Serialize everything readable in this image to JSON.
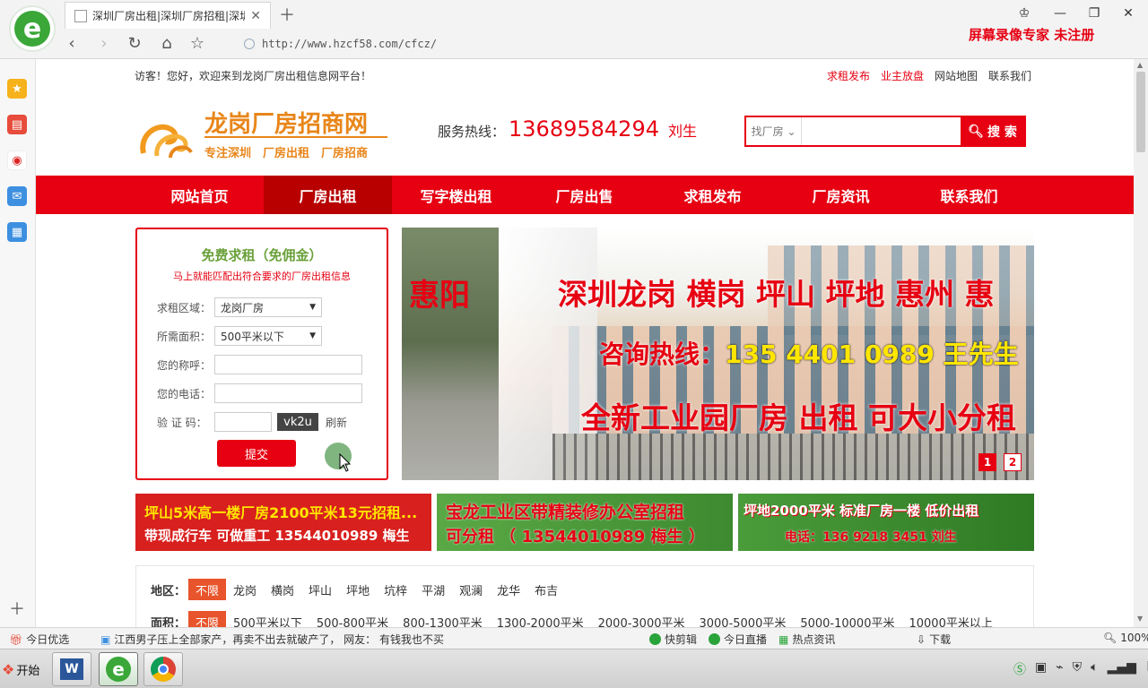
{
  "browser": {
    "tab_title": "深圳厂房出租|深圳厂房招租|深圳",
    "url": "http://www.hzcf58.com/cfcz/",
    "watermark": "屏幕录像专家  未注册",
    "zoom": "100%"
  },
  "site": {
    "welcome": "访客！您好，欢迎来到龙岗厂房出租信息网平台！",
    "top_links": [
      "求租发布",
      "业主放盘",
      "网站地图",
      "联系我们"
    ],
    "logo_name": "龙岗厂房招商网",
    "logo_slogan": "专注深圳　厂房出租　厂房招商",
    "hotline_label": "服务热线：",
    "hotline_number": "13689584294",
    "hotline_person": "刘生",
    "search_select": "找厂房",
    "search_button": "搜 索",
    "nav": [
      "网站首页",
      "厂房出租",
      "写字楼出租",
      "厂房出售",
      "求租发布",
      "厂房资讯",
      "联系我们"
    ]
  },
  "form": {
    "title": "免费求租（免佣金）",
    "subtitle": "马上就能匹配出符合要求的厂房出租信息",
    "region_label": "求租区域：",
    "region_value": "龙岗厂房",
    "area_label": "所需面积：",
    "area_value": "500平米以下",
    "name_label": "您的称呼：",
    "phone_label": "您的电话：",
    "captcha_label": "验 证 码：",
    "captcha_code": "vk2u",
    "refresh": "刷新",
    "submit": "提交"
  },
  "banner": {
    "left_text": "惠阳",
    "line1": "深圳龙岗 横岗 坪山 坪地 惠州 惠",
    "line2_label": "咨询热线：",
    "line2_phone": "135 4401 0989 王先生",
    "line3": "全新工业园厂房 出租 可大小分租",
    "dots": [
      "1",
      "2"
    ]
  },
  "ads": [
    {
      "line1": "坪山5米高一楼厂房2100平米13元招租...",
      "line2": "带现成行车 可做重工  13544010989 梅生",
      "bg": "#d8201e"
    },
    {
      "line1": "宝龙工业区带精装修办公室招租",
      "line2": "可分租 （ 13544010989 梅生 ）",
      "bg": "#4b9a3a"
    },
    {
      "line1": "坪地2000平米 标准厂房一楼 低价出租",
      "line2": "电话：136 9218 3451 刘生",
      "bg": "#3c8f2e"
    }
  ],
  "filter": {
    "region_label": "地区：",
    "region_options": [
      "不限",
      "龙岗",
      "横岗",
      "坪山",
      "坪地",
      "坑梓",
      "平湖",
      "观澜",
      "龙华",
      "布吉"
    ],
    "area_label": "面积：",
    "area_options": [
      "不限",
      "500平米以下",
      "500-800平米",
      "800-1300平米",
      "1300-2000平米",
      "2000-3000平米",
      "3000-5000平米",
      "5000-10000平米",
      "10000平米以上"
    ]
  },
  "statusbar": {
    "today": "今日优选",
    "news": "江西男子压上全部家产，再卖不出去就破产了，  网友：  有钱我也不买",
    "kuaijianji": "快剪辑",
    "zhibo": "今日直播",
    "hot": "热点资讯",
    "download": "下载"
  },
  "taskbar": {
    "start": "开始"
  },
  "colors": {
    "brand_red": "#e60012",
    "nav_active": "#b80000",
    "form_title_green": "#6aa13a",
    "filter_active": "#e8542b"
  }
}
